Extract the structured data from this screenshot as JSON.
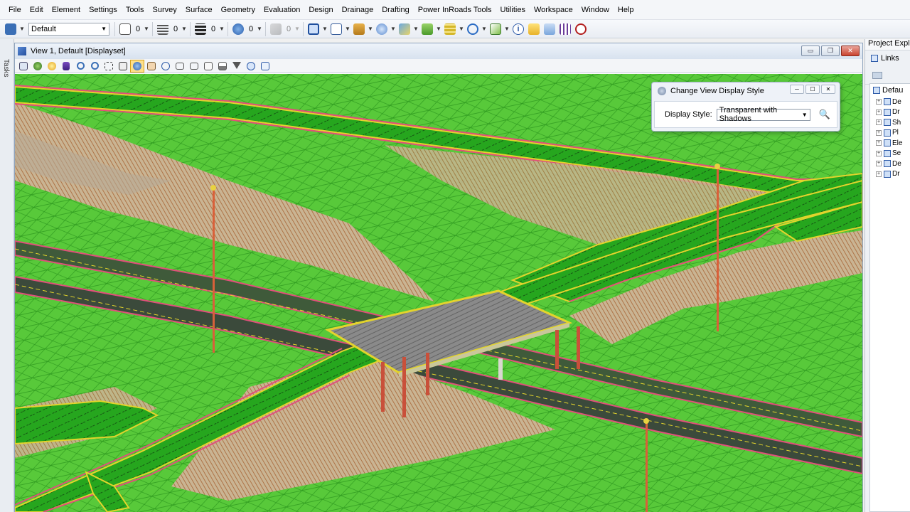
{
  "menu": [
    "File",
    "Edit",
    "Element",
    "Settings",
    "Tools",
    "Survey",
    "Surface",
    "Geometry",
    "Evaluation",
    "Design",
    "Drainage",
    "Drafting",
    "Power InRoads Tools",
    "Utilities",
    "Workspace",
    "Window",
    "Help"
  ],
  "toolbar": {
    "level_combo": "Default",
    "counts": [
      "0",
      "0",
      "0",
      "0",
      "0"
    ]
  },
  "tasks_label": "Tasks",
  "view": {
    "title": "View 1, Default [Displayset]",
    "minimize": "▭",
    "restore": "❐",
    "close": "✕"
  },
  "dialog": {
    "title": "Change View Display Style",
    "label": "Display Style:",
    "value": "Transparent with Shadows"
  },
  "right_panel": {
    "header": "Project Expl",
    "links": "Links",
    "root": "Defau",
    "items": [
      "De",
      "Dr",
      "Sh",
      "Pl",
      "Ele",
      "Se",
      "De",
      "Dr"
    ]
  },
  "colors": {
    "terrain": "#58c93a",
    "mesh": "#2e9a1f",
    "cut_fill": "#a86434",
    "pavement": "#26a61e",
    "edge_line": "#e3d42c",
    "curb": "#e0507a",
    "bridge_deck": "#7a7a7a"
  }
}
